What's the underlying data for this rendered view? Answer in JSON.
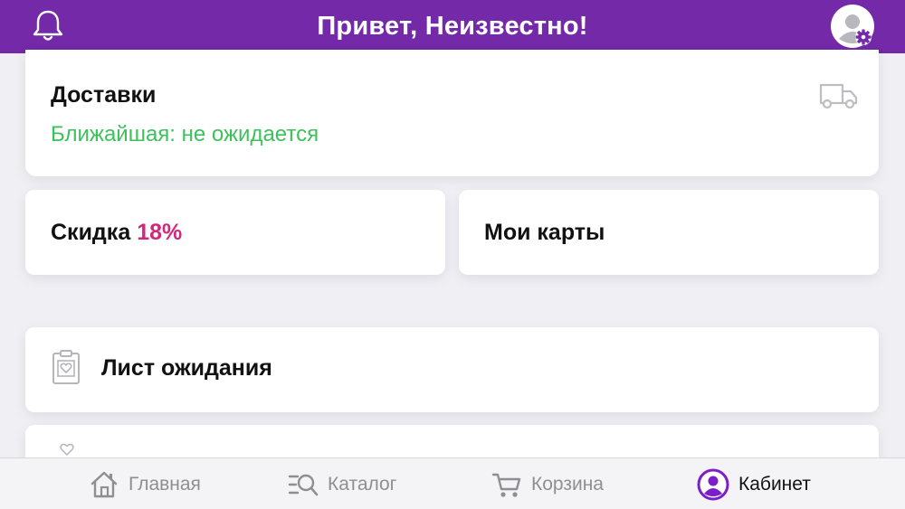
{
  "header": {
    "title": "Привет, Неизвестно!",
    "accent_color": "#7329a8",
    "left_icon": "bell-icon",
    "right_icon": "avatar-settings-icon"
  },
  "deliveries": {
    "title": "Доставки",
    "subtitle": "Ближайшая: не ожидается",
    "subtitle_color": "#3cc15b",
    "icon": "truck-icon"
  },
  "discount": {
    "label": "Скидка",
    "value": "18%",
    "value_color": "#d2287b"
  },
  "my_cards": {
    "label": "Мои карты"
  },
  "waitlist": {
    "label": "Лист ожидания",
    "icon": "clipboard-heart-icon"
  },
  "next_item": {
    "icon": "heart-icon"
  },
  "tabbar": {
    "items": [
      {
        "label": "Главная",
        "icon": "home-icon",
        "active": false
      },
      {
        "label": "Каталог",
        "icon": "catalog-search-icon",
        "active": false
      },
      {
        "label": "Корзина",
        "icon": "cart-icon",
        "active": false
      },
      {
        "label": "Кабинет",
        "icon": "profile-icon",
        "active": true
      }
    ],
    "active_color": "#7a1fc9",
    "inactive_color": "#8e8e93"
  }
}
